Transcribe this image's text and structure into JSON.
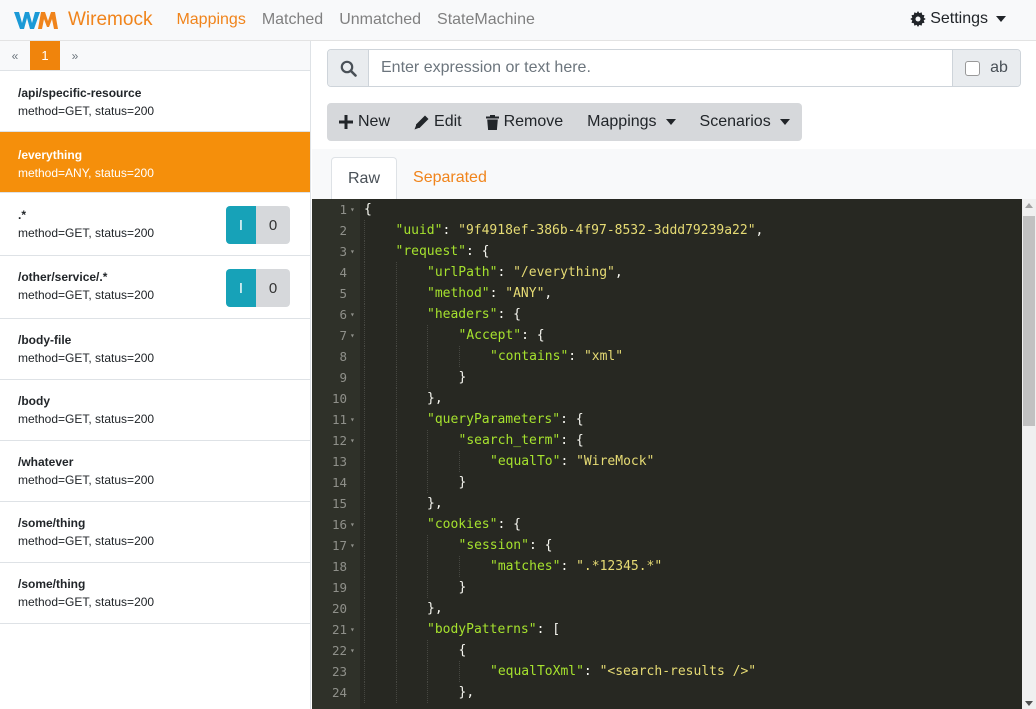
{
  "navbar": {
    "brand": "Wiremock",
    "links": [
      {
        "label": "Mappings",
        "active": true
      },
      {
        "label": "Matched",
        "active": false
      },
      {
        "label": "Unmatched",
        "active": false
      },
      {
        "label": "StateMachine",
        "active": false
      }
    ],
    "settings_label": "Settings",
    "accent": "#f0841b"
  },
  "pager": {
    "prev": "«",
    "page": "1",
    "next": "»"
  },
  "mappings": [
    {
      "url": "/api/specific-resource",
      "meta": "method=GET, status=200",
      "active": false,
      "badge": null
    },
    {
      "url": "/everything",
      "meta": "method=ANY, status=200",
      "active": true,
      "badge": null
    },
    {
      "url": ".*",
      "meta": "method=GET, status=200",
      "active": false,
      "badge": {
        "i": "I",
        "count": "0"
      }
    },
    {
      "url": "/other/service/.*",
      "meta": "method=GET, status=200",
      "active": false,
      "badge": {
        "i": "I",
        "count": "0"
      }
    },
    {
      "url": "/body-file",
      "meta": "method=GET, status=200",
      "active": false,
      "badge": null
    },
    {
      "url": "/body",
      "meta": "method=GET, status=200",
      "active": false,
      "badge": null
    },
    {
      "url": "/whatever",
      "meta": "method=GET, status=200",
      "active": false,
      "badge": null
    },
    {
      "url": "/some/thing",
      "meta": "method=GET, status=200",
      "active": false,
      "badge": null
    },
    {
      "url": "/some/thing",
      "meta": "method=GET, status=200",
      "active": false,
      "badge": null
    }
  ],
  "search": {
    "placeholder": "Enter expression or text here.",
    "option_label": "ab"
  },
  "toolbar": {
    "new_label": "New",
    "edit_label": "Edit",
    "remove_label": "Remove",
    "mappings_label": "Mappings",
    "scenarios_label": "Scenarios"
  },
  "tabs": [
    {
      "label": "Raw",
      "active": true
    },
    {
      "label": "Separated",
      "active": false
    }
  ],
  "editor_lines": [
    {
      "n": "1",
      "fold": true,
      "indent": 0,
      "tokens": [
        [
          "p",
          "{"
        ]
      ]
    },
    {
      "n": "2",
      "fold": false,
      "indent": 1,
      "tokens": [
        [
          "k",
          "\"uuid\""
        ],
        [
          "p",
          ": "
        ],
        [
          "s",
          "\"9f4918ef-386b-4f97-8532-3ddd79239a22\""
        ],
        [
          "p",
          ","
        ]
      ]
    },
    {
      "n": "3",
      "fold": true,
      "indent": 1,
      "tokens": [
        [
          "k",
          "\"request\""
        ],
        [
          "p",
          ": {"
        ]
      ]
    },
    {
      "n": "4",
      "fold": false,
      "indent": 2,
      "tokens": [
        [
          "k",
          "\"urlPath\""
        ],
        [
          "p",
          ": "
        ],
        [
          "s",
          "\"/everything\""
        ],
        [
          "p",
          ","
        ]
      ]
    },
    {
      "n": "5",
      "fold": false,
      "indent": 2,
      "tokens": [
        [
          "k",
          "\"method\""
        ],
        [
          "p",
          ": "
        ],
        [
          "s",
          "\"ANY\""
        ],
        [
          "p",
          ","
        ]
      ]
    },
    {
      "n": "6",
      "fold": true,
      "indent": 2,
      "tokens": [
        [
          "k",
          "\"headers\""
        ],
        [
          "p",
          ": {"
        ]
      ]
    },
    {
      "n": "7",
      "fold": true,
      "indent": 3,
      "tokens": [
        [
          "k",
          "\"Accept\""
        ],
        [
          "p",
          ": {"
        ]
      ]
    },
    {
      "n": "8",
      "fold": false,
      "indent": 4,
      "tokens": [
        [
          "k",
          "\"contains\""
        ],
        [
          "p",
          ": "
        ],
        [
          "s",
          "\"xml\""
        ]
      ]
    },
    {
      "n": "9",
      "fold": false,
      "indent": 3,
      "tokens": [
        [
          "p",
          "}"
        ]
      ]
    },
    {
      "n": "10",
      "fold": false,
      "indent": 2,
      "tokens": [
        [
          "p",
          "},"
        ]
      ]
    },
    {
      "n": "11",
      "fold": true,
      "indent": 2,
      "tokens": [
        [
          "k",
          "\"queryParameters\""
        ],
        [
          "p",
          ": {"
        ]
      ]
    },
    {
      "n": "12",
      "fold": true,
      "indent": 3,
      "tokens": [
        [
          "k",
          "\"search_term\""
        ],
        [
          "p",
          ": {"
        ]
      ]
    },
    {
      "n": "13",
      "fold": false,
      "indent": 4,
      "tokens": [
        [
          "k",
          "\"equalTo\""
        ],
        [
          "p",
          ": "
        ],
        [
          "s",
          "\"WireMock\""
        ]
      ]
    },
    {
      "n": "14",
      "fold": false,
      "indent": 3,
      "tokens": [
        [
          "p",
          "}"
        ]
      ]
    },
    {
      "n": "15",
      "fold": false,
      "indent": 2,
      "tokens": [
        [
          "p",
          "},"
        ]
      ]
    },
    {
      "n": "16",
      "fold": true,
      "indent": 2,
      "tokens": [
        [
          "k",
          "\"cookies\""
        ],
        [
          "p",
          ": {"
        ]
      ]
    },
    {
      "n": "17",
      "fold": true,
      "indent": 3,
      "tokens": [
        [
          "k",
          "\"session\""
        ],
        [
          "p",
          ": {"
        ]
      ]
    },
    {
      "n": "18",
      "fold": false,
      "indent": 4,
      "tokens": [
        [
          "k",
          "\"matches\""
        ],
        [
          "p",
          ": "
        ],
        [
          "s",
          "\".*12345.*\""
        ]
      ]
    },
    {
      "n": "19",
      "fold": false,
      "indent": 3,
      "tokens": [
        [
          "p",
          "}"
        ]
      ]
    },
    {
      "n": "20",
      "fold": false,
      "indent": 2,
      "tokens": [
        [
          "p",
          "},"
        ]
      ]
    },
    {
      "n": "21",
      "fold": true,
      "indent": 2,
      "tokens": [
        [
          "k",
          "\"bodyPatterns\""
        ],
        [
          "p",
          ": ["
        ]
      ]
    },
    {
      "n": "22",
      "fold": true,
      "indent": 3,
      "tokens": [
        [
          "p",
          "{"
        ]
      ]
    },
    {
      "n": "23",
      "fold": false,
      "indent": 4,
      "tokens": [
        [
          "k",
          "\"equalToXml\""
        ],
        [
          "p",
          ": "
        ],
        [
          "s",
          "\"<search-results />\""
        ]
      ]
    },
    {
      "n": "24",
      "fold": false,
      "indent": 3,
      "tokens": [
        [
          "p",
          "},"
        ]
      ]
    }
  ]
}
